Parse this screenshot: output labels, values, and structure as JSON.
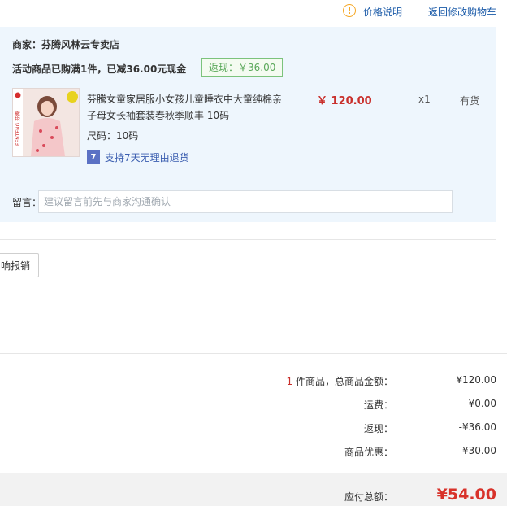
{
  "header": {
    "price_info": "价格说明",
    "back_to_cart": "返回修改购物车"
  },
  "merchant": {
    "label": "商家：芬腾风林云专卖店",
    "promo_text": "活动商品已购满1件，已减36.00元现金",
    "rebate_tag": "返现：￥36.00"
  },
  "product": {
    "title": "芬騰女童家居服小女孩儿童睡衣中大童纯棉亲子母女长袖套装春秋季顺丰 10码",
    "price": "￥ 120.00",
    "quantity": "x1",
    "stock": "有货",
    "size": "尺码：10码",
    "return_badge": "7",
    "return_policy": "支持7天无理由退货",
    "thumb_brand": "FENTENG 芬腾"
  },
  "message": {
    "label": "留言：",
    "placeholder": "建议留言前先与商家沟通确认"
  },
  "invoice": {
    "button_label": "响报销"
  },
  "summary": {
    "count": "1",
    "items_label": "件商品，总商品金额：",
    "items_amount": "¥120.00",
    "shipping_label": "运费：",
    "shipping_amount": "¥0.00",
    "rebate_label": "返现：",
    "rebate_amount": "-¥36.00",
    "discount_label": "商品优惠：",
    "discount_amount": "-¥30.00",
    "total_label": "应付总额：",
    "total_amount": "¥54.00"
  },
  "colors": {
    "accent_red": "#d8322a",
    "link_blue": "#1a5aa8",
    "panel_bg": "#eef6fd",
    "rebate_green": "#5aa85a"
  }
}
